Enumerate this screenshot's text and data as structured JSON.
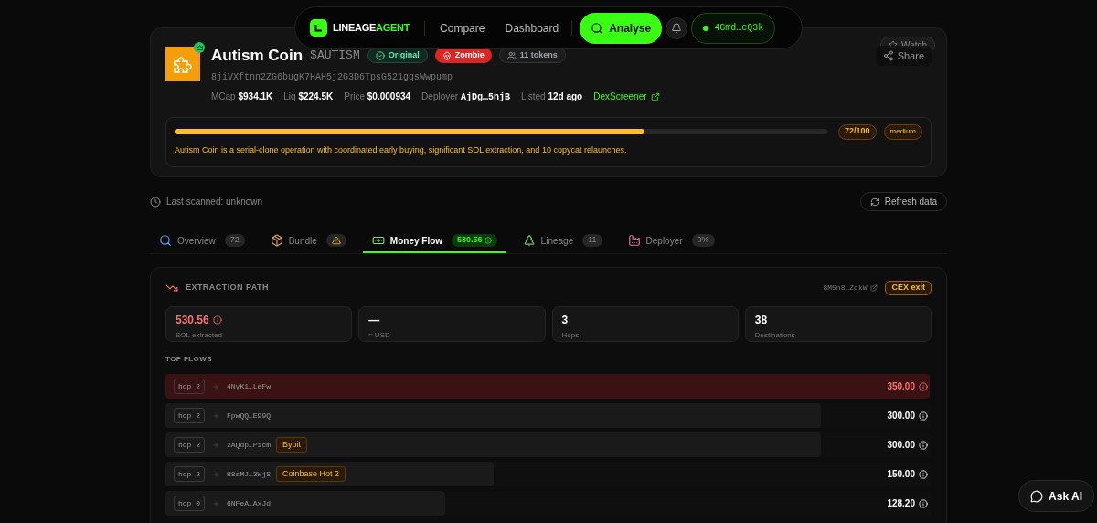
{
  "nav": {
    "brand_first": "LINEAGE",
    "brand_second": "AGENT",
    "links": [
      "Compare",
      "Dashboard"
    ],
    "analyse_button": "Analyse",
    "wallet": "4Gmd…cQ3k"
  },
  "token": {
    "name": "Autism Coin",
    "ticker": "$AUTISM",
    "badges": [
      {
        "kind": "original",
        "label": "Original"
      },
      {
        "kind": "zombie",
        "label": "Zombie"
      },
      {
        "kind": "tokens",
        "label": "11 tokens"
      }
    ],
    "address": "8jiVXftnn2ZG6bugK7HAH5j2G3D6TpsG521gqsWwpump",
    "stats": [
      {
        "kind": "amount",
        "label": "MCap",
        "value": "$934.1K"
      },
      {
        "kind": "amount",
        "label": "Liq",
        "value": "$224.5K"
      },
      {
        "kind": "amount",
        "label": "Price",
        "value": "$0.000934"
      },
      {
        "kind": "address",
        "label": "Deployer",
        "value": "AjDg…5njB"
      },
      {
        "kind": "amount",
        "label": "Listed",
        "value": "12d ago"
      }
    ],
    "dex_link": "DexScreener",
    "watch_button": "Watch",
    "share_button": "Share",
    "risk": {
      "level": 0.72,
      "score": "72/100",
      "severity": "medium",
      "summary": "Autism Coin is a serial-clone operation with coordinated early buying, significant SOL extraction, and 10 copycat relaunches."
    }
  },
  "scan": {
    "last_scanned": "Last scanned: unknown",
    "refresh_button": "Refresh data"
  },
  "tabs": [
    {
      "kind": "overview",
      "label": "Overview",
      "badge": "72",
      "selected": false
    },
    {
      "kind": "bundle",
      "label": "Bundle",
      "selected": false
    },
    {
      "kind": "money",
      "label": "Money Flow",
      "badge": "530.56",
      "selected": true
    },
    {
      "kind": "lineage",
      "label": "Lineage",
      "badge": "11",
      "selected": false
    },
    {
      "kind": "deployer",
      "label": "Deployer",
      "badge": "0%",
      "selected": false
    }
  ],
  "extraction": {
    "title": "EXTRACTION PATH",
    "address": "8M5n8…ZckW",
    "exit_badge": "CEX exit",
    "metrics": [
      {
        "value": "530.56",
        "label": "SOL extracted",
        "alert": true
      },
      {
        "value": "—",
        "label": "≈ USD",
        "alert": false
      },
      {
        "value": "3",
        "label": "Hops",
        "alert": false
      },
      {
        "value": "38",
        "label": "Destinations",
        "alert": false
      }
    ],
    "top_flows_title": "TOP FLOWS",
    "flows": [
      {
        "hop": "hop 2",
        "address": "4NyK1…LeFw",
        "value": "350.00",
        "level": 1.0,
        "highlighted": true
      },
      {
        "hop": "hop 2",
        "address": "FpwQQ…E99Q",
        "value": "300.00",
        "level": 0.858,
        "highlighted": false
      },
      {
        "hop": "hop 2",
        "address": "2AQdp…Picm",
        "tag": "Bybit",
        "value": "300.00",
        "level": 0.858,
        "highlighted": false
      },
      {
        "hop": "hop 2",
        "address": "H8sMJ…3WjS",
        "tag": "Coinbase Hot 2",
        "value": "150.00",
        "level": 0.43,
        "highlighted": false
      },
      {
        "hop": "hop 0",
        "address": "6NFeA…AxJd",
        "value": "128.20",
        "level": 0.366,
        "highlighted": false
      }
    ]
  },
  "ask_ai_button": "Ask AI"
}
